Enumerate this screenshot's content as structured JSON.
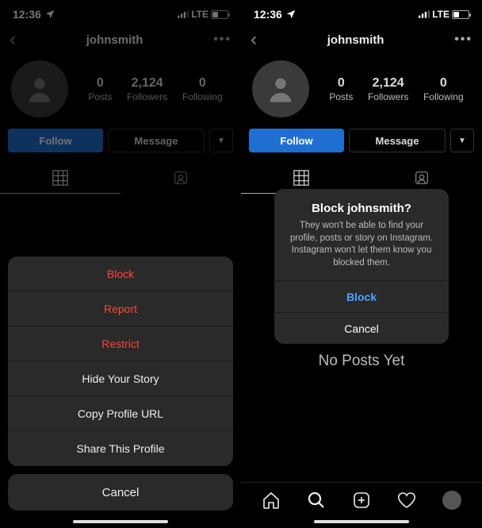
{
  "status": {
    "time": "12:36",
    "net": "LTE"
  },
  "profile": {
    "username": "johnsmith",
    "stats": {
      "posts": {
        "count": "0",
        "label": "Posts"
      },
      "followers": {
        "count": "2,124",
        "label": "Followers"
      },
      "following": {
        "count": "0",
        "label": "Following"
      }
    },
    "follow_label": "Follow",
    "message_label": "Message"
  },
  "action_sheet": {
    "items": [
      {
        "label": "Block",
        "destructive": true
      },
      {
        "label": "Report",
        "destructive": true
      },
      {
        "label": "Restrict",
        "destructive": true
      },
      {
        "label": "Hide Your Story",
        "destructive": false
      },
      {
        "label": "Copy Profile URL",
        "destructive": false
      },
      {
        "label": "Share This Profile",
        "destructive": false
      }
    ],
    "cancel": "Cancel"
  },
  "confirm_dialog": {
    "title": "Block johnsmith?",
    "message": "They won't be able to find your profile, posts or story on Instagram. Instagram won't let them know you blocked them.",
    "primary": "Block",
    "cancel": "Cancel"
  },
  "empty_state": "No Posts Yet"
}
